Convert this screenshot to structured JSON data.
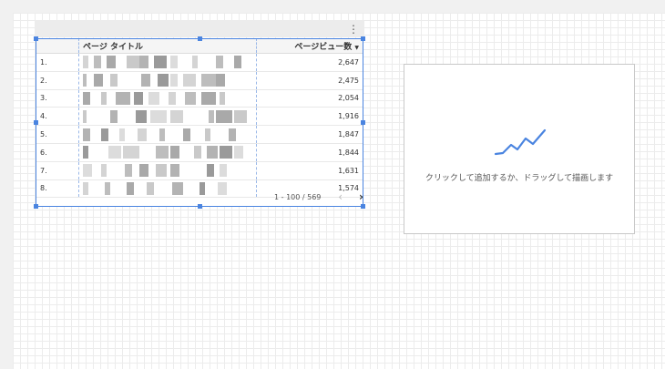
{
  "table": {
    "header": {
      "title_col": "ページ タイトル",
      "views_col": "ページビュー数",
      "sort_icon": "sort-desc-icon"
    },
    "rows": [
      {
        "index": "1.",
        "views": "2,647"
      },
      {
        "index": "2.",
        "views": "2,475"
      },
      {
        "index": "3.",
        "views": "2,054"
      },
      {
        "index": "4.",
        "views": "1,916"
      },
      {
        "index": "5.",
        "views": "1,847"
      },
      {
        "index": "6.",
        "views": "1,844"
      },
      {
        "index": "7.",
        "views": "1,631"
      },
      {
        "index": "8.",
        "views": "1,574"
      }
    ],
    "pager": {
      "range": "1 - 100 / 569"
    }
  },
  "placeholder": {
    "hint": "クリックして追加するか、ドラッグして描画します",
    "icon": "line-chart-icon",
    "icon_color": "#4a84e0"
  },
  "colors": {
    "selection": "#4a84e0",
    "canvas_grid": "#ececec"
  }
}
